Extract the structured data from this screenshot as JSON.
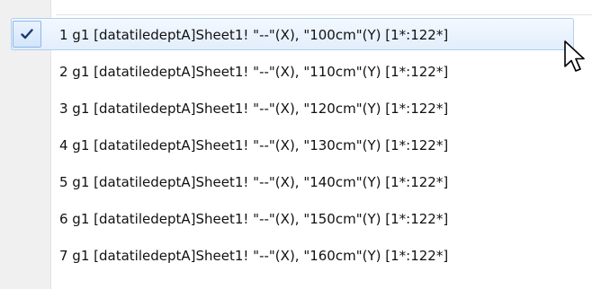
{
  "menu": {
    "items": [
      {
        "label": "1 g1 [datatiledeptA]Sheet1! \"--\"(X), \"100cm\"(Y) [1*:122*]",
        "checked": true
      },
      {
        "label": "2 g1 [datatiledeptA]Sheet1! \"--\"(X), \"110cm\"(Y) [1*:122*]",
        "checked": false
      },
      {
        "label": "3 g1 [datatiledeptA]Sheet1! \"--\"(X), \"120cm\"(Y) [1*:122*]",
        "checked": false
      },
      {
        "label": "4 g1 [datatiledeptA]Sheet1! \"--\"(X), \"130cm\"(Y) [1*:122*]",
        "checked": false
      },
      {
        "label": "5 g1 [datatiledeptA]Sheet1! \"--\"(X), \"140cm\"(Y) [1*:122*]",
        "checked": false
      },
      {
        "label": "6 g1 [datatiledeptA]Sheet1! \"--\"(X), \"150cm\"(Y) [1*:122*]",
        "checked": false
      },
      {
        "label": "7 g1 [datatiledeptA]Sheet1! \"--\"(X), \"160cm\"(Y) [1*:122*]",
        "checked": false
      }
    ]
  },
  "icons": {
    "check": "checkmark-icon",
    "cursor": "mouse-pointer-icon"
  },
  "colors": {
    "highlight_border": "#aecff7",
    "highlight_fill": "#e3eefc",
    "check_color": "#1a3a6e",
    "gutter": "#f0f0f0"
  }
}
